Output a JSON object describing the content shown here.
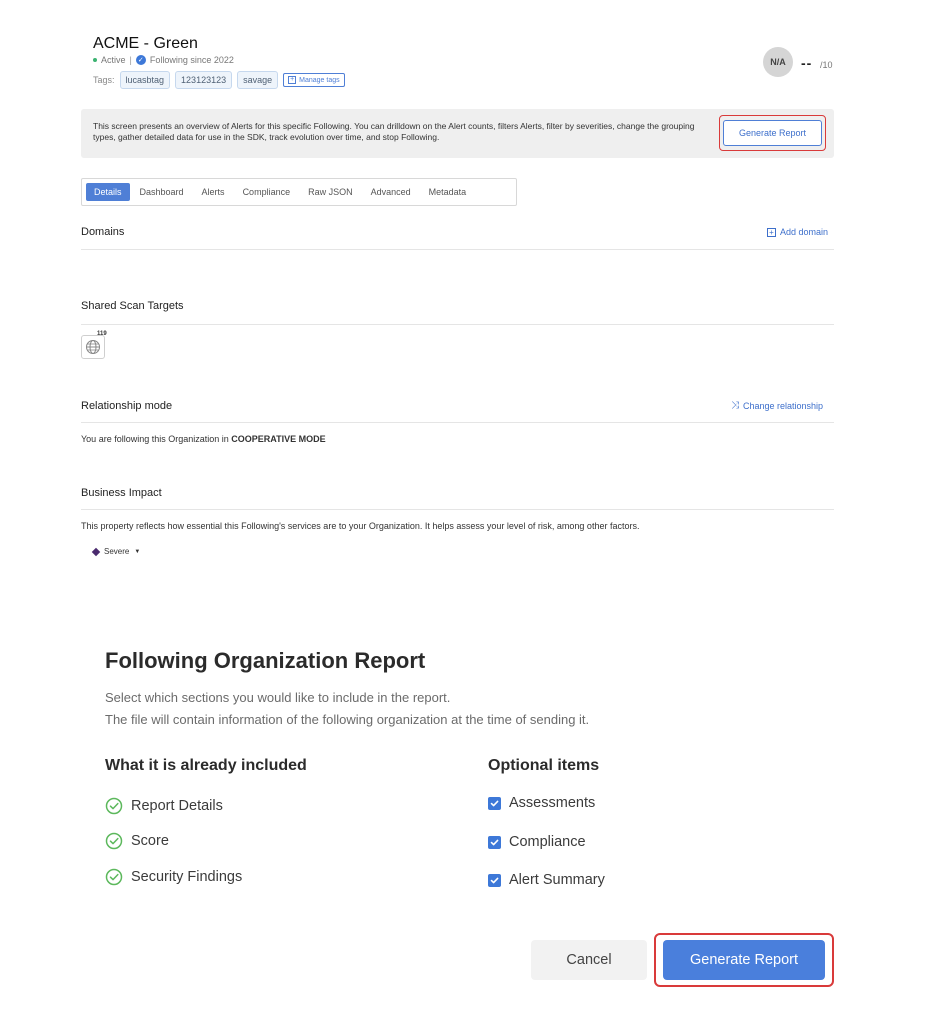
{
  "header": {
    "title": "ACME - Green",
    "status": "Active",
    "following_since": "Following since 2022",
    "tags_label": "Tags:",
    "tags": [
      "lucasbtag",
      "123123123",
      "savage"
    ],
    "manage_tags": "Manage tags",
    "avatar_text": "N/A",
    "score": "--",
    "score_of": "/10"
  },
  "banner": {
    "text": "This screen presents an overview of Alerts for this specific Following. You can drilldown on the Alert counts, filters Alerts, filter by severities, change the grouping types, gather detailed data for use in the SDK, track evolution over time, and stop Following.",
    "button": "Generate Report"
  },
  "tabs": [
    "Details",
    "Dashboard",
    "Alerts",
    "Compliance",
    "Raw JSON",
    "Advanced",
    "Metadata"
  ],
  "sections": {
    "domains": {
      "title": "Domains",
      "action": "Add domain"
    },
    "shared": {
      "title": "Shared Scan Targets",
      "badge": "119"
    },
    "relationship": {
      "title": "Relationship mode",
      "action": "Change relationship",
      "text_prefix": "You are following this Organization in ",
      "mode": "COOPERATIVE MODE"
    },
    "impact": {
      "title": "Business Impact",
      "text": "This property reflects how essential this Following's services are to your Organization. It helps assess your level of risk, among other factors.",
      "severity": "Severe"
    }
  },
  "modal": {
    "title": "Following Organization Report",
    "desc_line1": "Select which sections you would like to include in the report.",
    "desc_line2": "The file will contain information of the following organization at the time of sending it.",
    "included_title": "What it is already included",
    "included": [
      "Report Details",
      "Score",
      "Security Findings"
    ],
    "optional_title": "Optional items",
    "optional": [
      "Assessments",
      "Compliance",
      "Alert Summary"
    ],
    "cancel": "Cancel",
    "generate": "Generate Report"
  },
  "colors": {
    "accent": "#4a7fdc",
    "highlight": "#d93a3a",
    "check_green": "#5cb85c"
  }
}
